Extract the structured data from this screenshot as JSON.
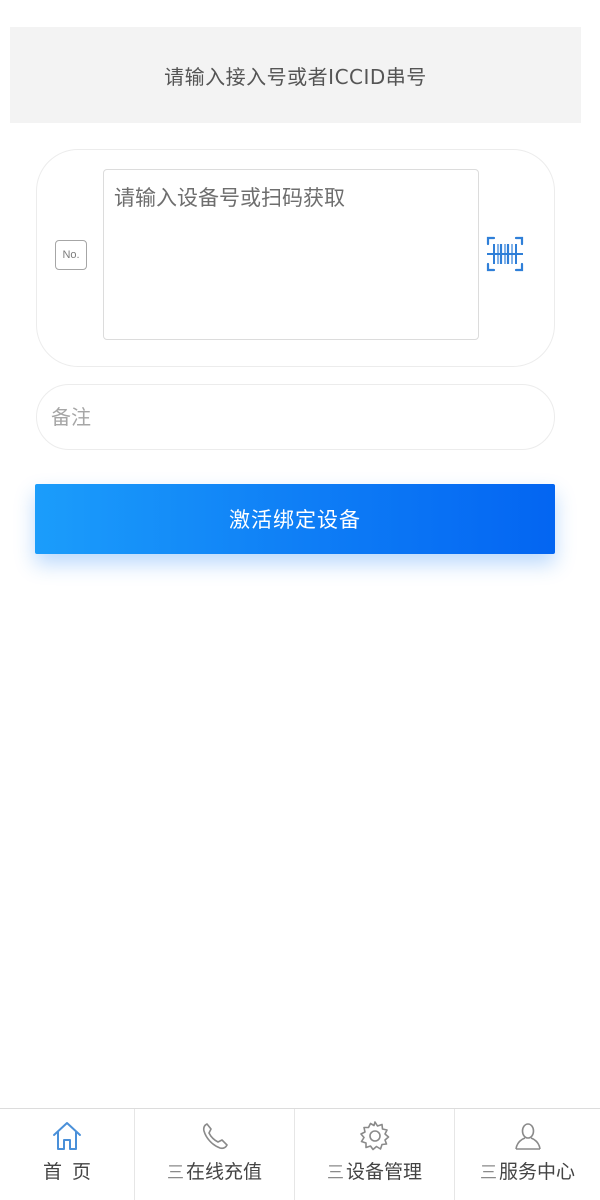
{
  "header": {
    "iccid_placeholder": "请输入接入号或者ICCID串号"
  },
  "device_card": {
    "no_icon_text": "No.",
    "device_placeholder": "请输入设备号或扫码获取",
    "scan_icon": "barcode-scan-icon"
  },
  "remark": {
    "placeholder": "备注"
  },
  "activate_button": {
    "label": "激活绑定设备"
  },
  "colors": {
    "accent": "#0f7ff6",
    "gradient_start": "#1b9dfb",
    "gradient_end": "#0365f2",
    "active_tab_icon": "#4a90d9"
  },
  "tabbar": {
    "tabs": [
      {
        "icon": "home-icon",
        "prefix": "",
        "label": "首页",
        "active": true
      },
      {
        "icon": "phone-icon",
        "prefix": "三",
        "label": "在线充值",
        "active": false
      },
      {
        "icon": "gear-icon",
        "prefix": "三",
        "label": "设备管理",
        "active": false
      },
      {
        "icon": "user-icon",
        "prefix": "三",
        "label": "服务中心",
        "active": false
      }
    ]
  }
}
